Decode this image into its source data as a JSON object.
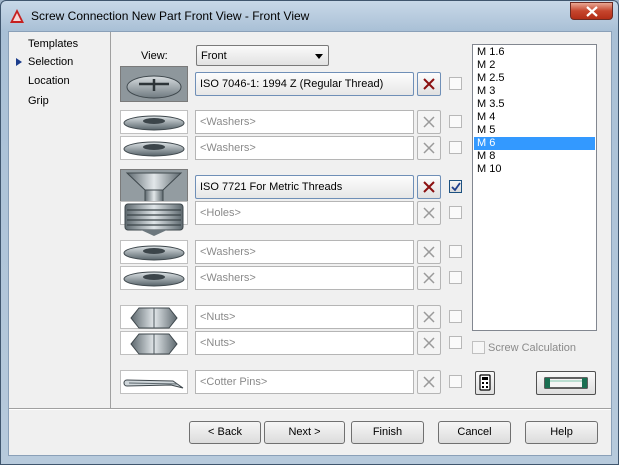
{
  "window": {
    "title": "Screw Connection New Part Front View - Front View"
  },
  "nav": [
    {
      "label": "Templates"
    },
    {
      "label": "Selection",
      "current": true
    },
    {
      "label": "Location"
    },
    {
      "label": "Grip"
    }
  ],
  "view": {
    "label": "View:",
    "value": "Front"
  },
  "rows": [
    {
      "thumb": "screw-head-icon",
      "text": "ISO 7046-1: 1994 Z  (Regular Thread)",
      "active": true,
      "checked": false
    },
    {
      "thumb": "washer-icon",
      "text": "<Washers>",
      "active": false,
      "checked": false
    },
    {
      "thumb": "washer-icon",
      "text": "<Washers>",
      "active": false,
      "checked": false
    },
    {
      "thumb": "countersunk-screw-icon",
      "text": "ISO 7721  For Metric Threads",
      "active": true,
      "checked": true
    },
    {
      "thumb": "threaded-hole-icon",
      "text": "<Holes>",
      "active": false,
      "checked": false
    },
    {
      "thumb": "washer-icon",
      "text": "<Washers>",
      "active": false,
      "checked": false
    },
    {
      "thumb": "washer-icon",
      "text": "<Washers>",
      "active": false,
      "checked": false
    },
    {
      "thumb": "hex-nut-icon",
      "text": "<Nuts>",
      "active": false,
      "checked": false
    },
    {
      "thumb": "hex-nut-icon",
      "text": "<Nuts>",
      "active": false,
      "checked": false
    },
    {
      "thumb": "cotter-pin-icon",
      "text": "<Cotter Pins>",
      "active": false,
      "checked": false
    }
  ],
  "sizes": {
    "items": [
      "M 1.6",
      "M 2",
      "M 2.5",
      "M 3",
      "M 3.5",
      "M 4",
      "M 5",
      "M 6",
      "M 8",
      "M 10"
    ],
    "selected": "M 6"
  },
  "screw_calculation": {
    "label": "Screw Calculation",
    "checked": false
  },
  "buttons": {
    "back": "< Back",
    "next": "Next >",
    "finish": "Finish",
    "cancel": "Cancel",
    "help": "Help"
  }
}
